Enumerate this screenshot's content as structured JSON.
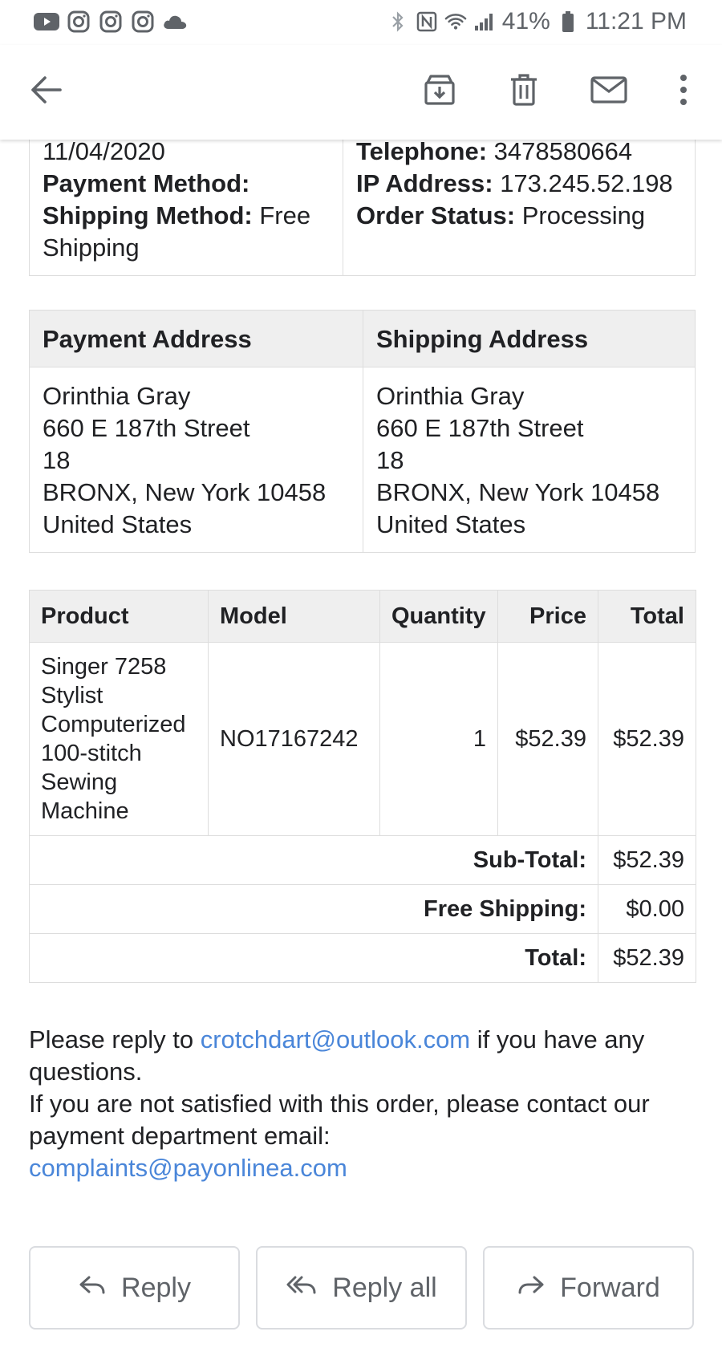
{
  "status_bar": {
    "battery": "41%",
    "time": "11:21 PM",
    "left_icons": [
      "youtube-icon",
      "instagram-icon",
      "instagram-icon",
      "instagram-icon",
      "cloud-icon"
    ],
    "right_icons": [
      "bluetooth-icon",
      "nfc-icon",
      "wifi-icon",
      "signal-icon",
      "battery-icon"
    ]
  },
  "app_bar": {
    "icons": [
      "back-arrow-icon",
      "archive-icon",
      "delete-icon",
      "mark-unread-icon",
      "more-vert-icon"
    ]
  },
  "order_info": {
    "date_value": "11/04/2020",
    "payment_method_label": "Payment Method:",
    "payment_method_value": "",
    "shipping_method_label": "Shipping Method:",
    "shipping_method_value": "Free Shipping",
    "telephone_label": "Telephone:",
    "telephone_value": "3478580664",
    "ip_label": "IP Address:",
    "ip_value": "173.245.52.198",
    "status_label": "Order Status:",
    "status_value": "Processing"
  },
  "addresses": {
    "payment_header": "Payment Address",
    "shipping_header": "Shipping Address",
    "payment": {
      "name": "Orinthia Gray",
      "street": "660 E 187th Street",
      "unit": "18",
      "city_line": "BRONX, New York 10458",
      "country": "United States"
    },
    "shipping": {
      "name": "Orinthia Gray",
      "street": "660 E 187th Street",
      "unit": "18",
      "city_line": "BRONX, New York 10458",
      "country": "United States"
    }
  },
  "products": {
    "headers": [
      "Product",
      "Model",
      "Quantity",
      "Price",
      "Total"
    ],
    "rows": [
      {
        "product": "Singer 7258 Stylist Computerized 100-stitch Sewing Machine",
        "model": "NO17167242",
        "quantity": "1",
        "price": "$52.39",
        "total": "$52.39"
      }
    ],
    "totals": [
      {
        "label": "Sub-Total:",
        "value": "$52.39"
      },
      {
        "label": "Free Shipping:",
        "value": "$0.00"
      },
      {
        "label": "Total:",
        "value": "$52.39"
      }
    ]
  },
  "footer": {
    "reply_prefix": "Please reply to",
    "reply_email": "crotchdart@outlook.com",
    "reply_suffix": "if you have any questions.",
    "complaint_text": "If you are not satisfied with this order, please contact our payment department email:",
    "complaint_email": "complaints@payonlinea.com"
  },
  "actions": {
    "reply": "Reply",
    "reply_all": "Reply all",
    "forward": "Forward"
  },
  "colors": {
    "link": "#4a86d9",
    "header_bg": "#efefef",
    "border": "#dddddd",
    "icon": "#5f6368"
  }
}
